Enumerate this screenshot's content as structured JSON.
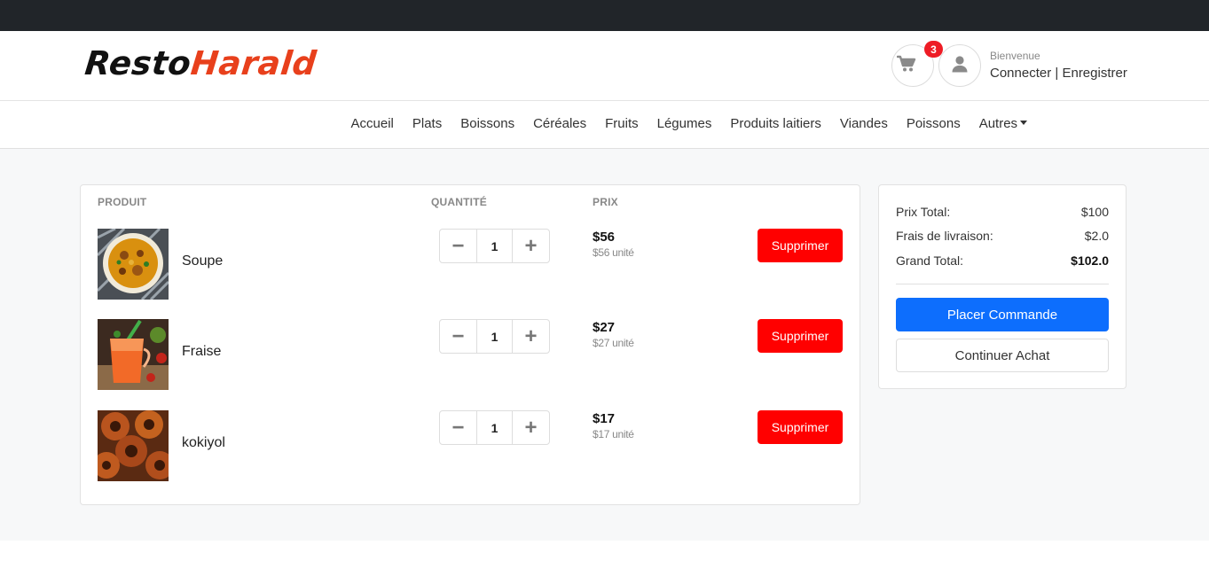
{
  "brand": {
    "part1": "Resto",
    "part2": "Harald",
    "accent": "#e8401c"
  },
  "header": {
    "cart_count": "3",
    "welcome": "Bienvenue",
    "login": "Connecter",
    "separator": "|",
    "register": "Enregistrer",
    "cart_icon": "shopping-cart-icon",
    "user_icon": "user-icon"
  },
  "nav": {
    "items": [
      "Accueil",
      "Plats",
      "Boissons",
      "Céréales",
      "Fruits",
      "Légumes",
      "Produits laitiers",
      "Viandes",
      "Poissons",
      "Autres"
    ]
  },
  "cart": {
    "columns": {
      "product": "PRODUIT",
      "quantity": "QUANTITÉ",
      "price": "PRIX"
    },
    "items": [
      {
        "name": "Soupe",
        "qty": "1",
        "price": "$56",
        "unit": "$56 unité",
        "delete": "Supprimer"
      },
      {
        "name": "Fraise",
        "qty": "1",
        "price": "$27",
        "unit": "$27 unité",
        "delete": "Supprimer"
      },
      {
        "name": "kokiyol",
        "qty": "1",
        "price": "$17",
        "unit": "$17 unité",
        "delete": "Supprimer"
      }
    ]
  },
  "summary": {
    "subtotal_label": "Prix Total:",
    "subtotal": "$100",
    "delivery_label": "Frais de livraison:",
    "delivery": "$2.0",
    "total_label": "Grand Total:",
    "total": "$102.0",
    "order_button": "Placer Commande",
    "continue_button": "Continuer Achat"
  },
  "colors": {
    "primary": "#0d6efd",
    "danger": "#ff0000",
    "badge": "#ee1c25",
    "topbar": "#212529"
  }
}
